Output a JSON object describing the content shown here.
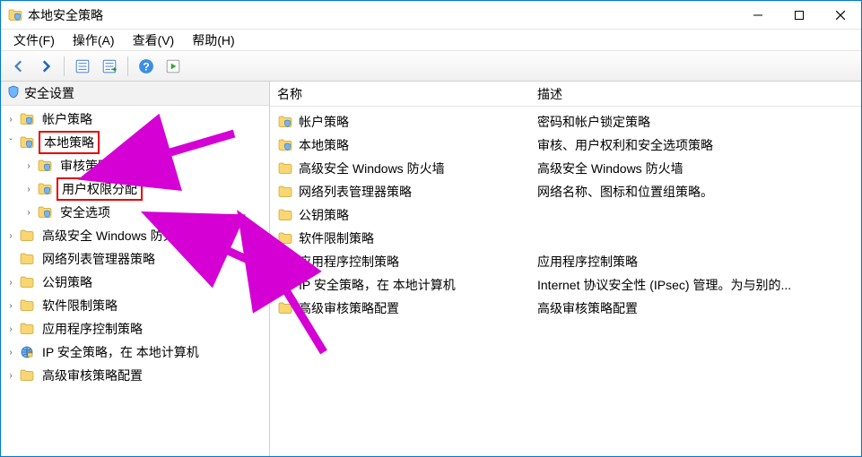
{
  "window": {
    "title": "本地安全策略"
  },
  "menus": {
    "file": "文件(F)",
    "action": "操作(A)",
    "view": "查看(V)",
    "help": "帮助(H)"
  },
  "toolbar": {
    "back": "back",
    "forward": "forward",
    "up": "up",
    "export": "export",
    "help": "help",
    "prop": "properties"
  },
  "tree": {
    "root": "安全设置",
    "nodes": [
      {
        "label": "帐户策略",
        "icon": "folder-policy",
        "expandable": true
      },
      {
        "label": "本地策略",
        "icon": "folder-policy",
        "expandable": true,
        "expanded": true,
        "highlight": true,
        "children": [
          {
            "label": "审核策略",
            "icon": "folder-policy",
            "expandable": true
          },
          {
            "label": "用户权限分配",
            "icon": "folder-policy",
            "expandable": true,
            "highlight": true
          },
          {
            "label": "安全选项",
            "icon": "folder-policy",
            "expandable": true
          }
        ]
      },
      {
        "label": "高级安全 Windows 防火墙",
        "icon": "folder",
        "expandable": true,
        "truncated": true,
        "display": "高级安全 Windows 防火墙"
      },
      {
        "label": "网络列表管理器策略",
        "icon": "folder",
        "expandable": false
      },
      {
        "label": "公钥策略",
        "icon": "folder",
        "expandable": true
      },
      {
        "label": "软件限制策略",
        "icon": "folder",
        "expandable": true
      },
      {
        "label": "应用程序控制策略",
        "icon": "folder",
        "expandable": true
      },
      {
        "label": "IP 安全策略，在 本地计算机",
        "icon": "ipsec",
        "expandable": true
      },
      {
        "label": "高级审核策略配置",
        "icon": "folder",
        "expandable": true
      }
    ]
  },
  "list": {
    "headers": {
      "name": "名称",
      "desc": "描述"
    },
    "rows": [
      {
        "name": "帐户策略",
        "desc": "密码和帐户锁定策略",
        "icon": "folder-policy"
      },
      {
        "name": "本地策略",
        "desc": "审核、用户权利和安全选项策略",
        "icon": "folder-policy"
      },
      {
        "name": "高级安全 Windows 防火墙",
        "desc": "高级安全 Windows 防火墙",
        "icon": "folder"
      },
      {
        "name": "网络列表管理器策略",
        "desc": "网络名称、图标和位置组策略。",
        "icon": "folder"
      },
      {
        "name": "公钥策略",
        "desc": "",
        "icon": "folder"
      },
      {
        "name": "软件限制策略",
        "desc": "",
        "icon": "folder"
      },
      {
        "name": "应用程序控制策略",
        "desc": "应用程序控制策略",
        "icon": "folder"
      },
      {
        "name": "IP 安全策略，在 本地计算机",
        "desc": "Internet 协议安全性 (IPsec) 管理。为与别的...",
        "icon": "ipsec"
      },
      {
        "name": "高级审核策略配置",
        "desc": "高级审核策略配置",
        "icon": "folder"
      }
    ]
  },
  "annotations": {
    "color": "#d400d4"
  }
}
